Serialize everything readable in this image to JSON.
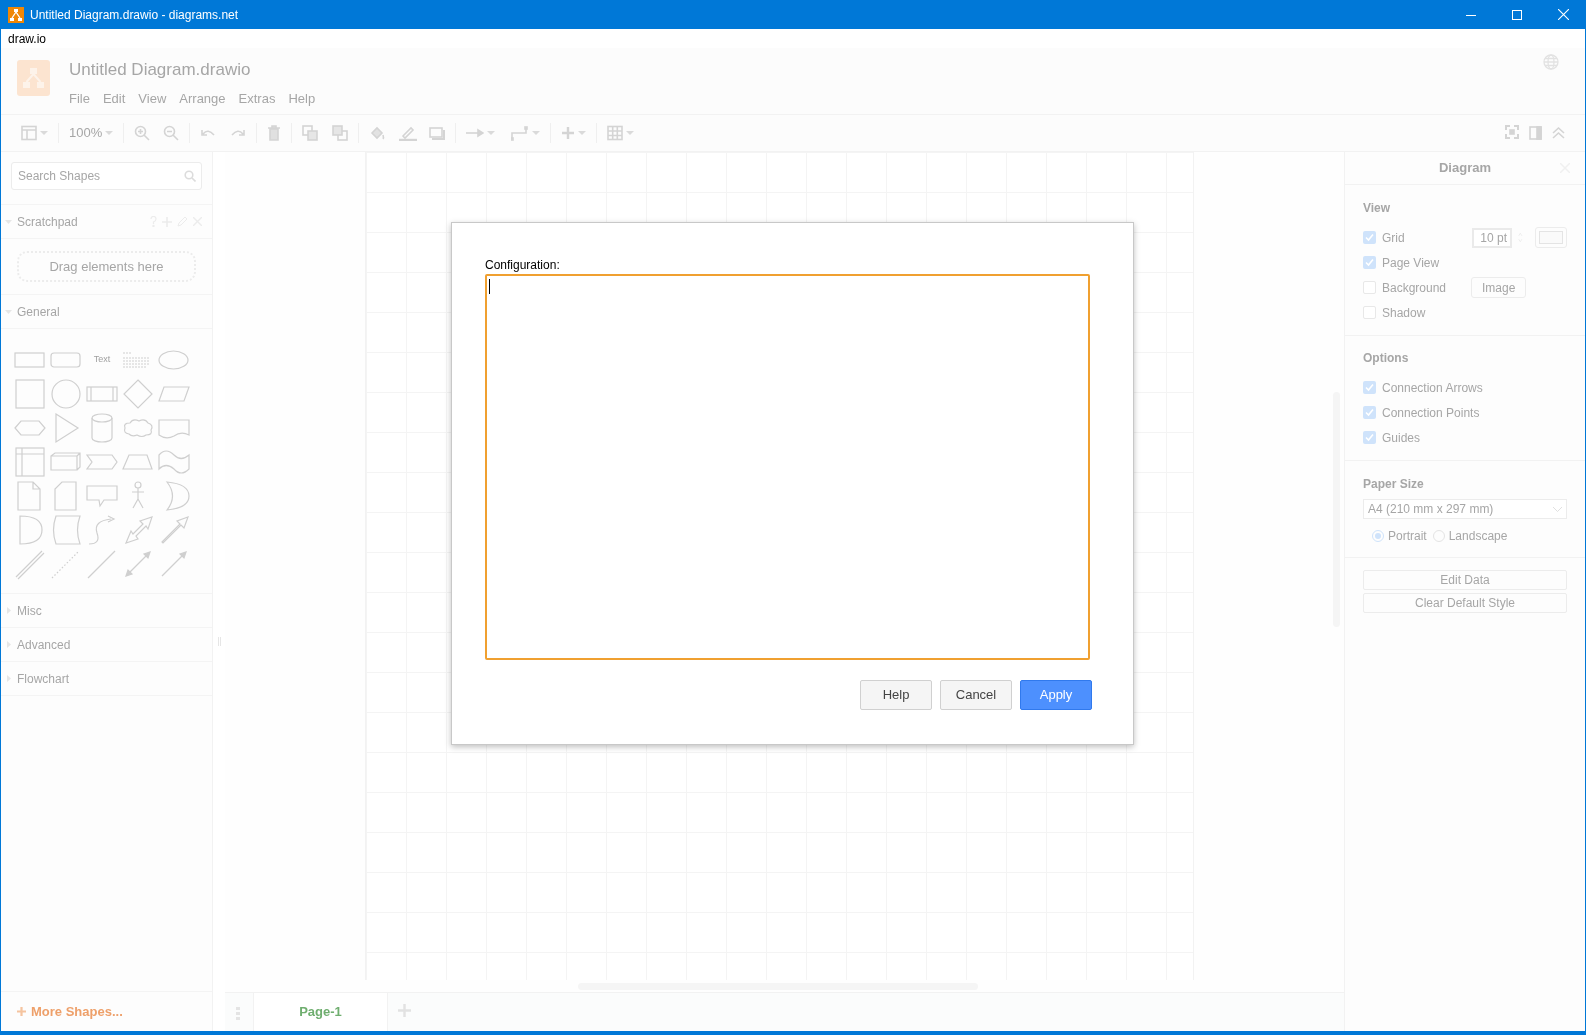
{
  "window": {
    "title": "Untitled Diagram.drawio - diagrams.net"
  },
  "app_menu": "draw.io",
  "header": {
    "title": "Untitled Diagram.drawio",
    "menus": [
      "File",
      "Edit",
      "View",
      "Arrange",
      "Extras",
      "Help"
    ]
  },
  "toolbar": {
    "zoom": "100%"
  },
  "sidebar": {
    "search": {
      "placeholder": "Search Shapes"
    },
    "sections": [
      {
        "title": "Scratchpad",
        "expanded": true,
        "kind": "scratchpad",
        "hint": "Drag elements here"
      },
      {
        "title": "General",
        "expanded": true,
        "kind": "shapes",
        "text_shape": "Text"
      },
      {
        "title": "Misc",
        "expanded": false,
        "kind": "shapes"
      },
      {
        "title": "Advanced",
        "expanded": false,
        "kind": "shapes"
      },
      {
        "title": "Flowchart",
        "expanded": false,
        "kind": "shapes"
      }
    ],
    "more_shapes": "More Shapes..."
  },
  "pages": [
    {
      "label": "Page-1",
      "selected": true
    }
  ],
  "format_panel": {
    "title": "Diagram",
    "view": {
      "title": "View",
      "items": [
        {
          "label": "Grid",
          "checked": true,
          "field": "10 pt"
        },
        {
          "label": "Page View",
          "checked": true
        },
        {
          "label": "Background",
          "checked": false,
          "button": "Image"
        },
        {
          "label": "Shadow",
          "checked": false
        }
      ]
    },
    "options": {
      "title": "Options",
      "items": [
        {
          "label": "Connection Arrows",
          "checked": true
        },
        {
          "label": "Connection Points",
          "checked": true
        },
        {
          "label": "Guides",
          "checked": true
        }
      ]
    },
    "paper": {
      "title": "Paper Size",
      "value": "A4 (210 mm x 297 mm)",
      "orientations": [
        {
          "label": "Portrait",
          "selected": true
        },
        {
          "label": "Landscape",
          "selected": false
        }
      ]
    },
    "buttons": [
      "Edit Data",
      "Clear Default Style"
    ]
  },
  "dialog": {
    "label": "Configuration:",
    "buttons": [
      {
        "label": "Help",
        "primary": false
      },
      {
        "label": "Cancel",
        "primary": false
      },
      {
        "label": "Apply",
        "primary": true
      }
    ]
  }
}
